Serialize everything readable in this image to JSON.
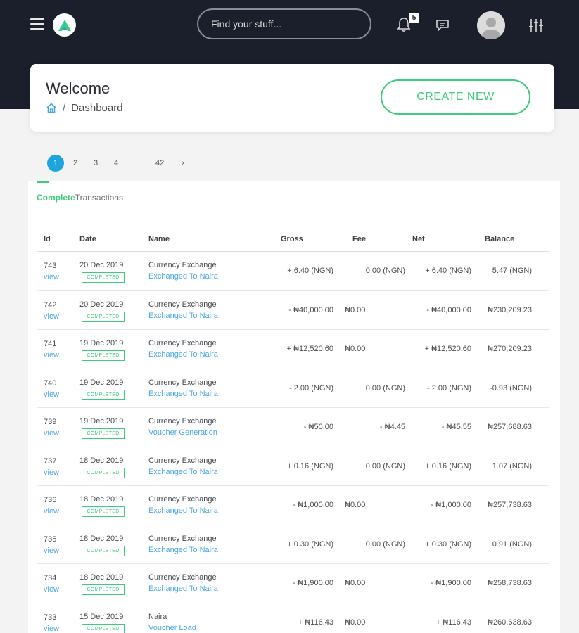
{
  "header": {
    "search_placeholder": "Find your stuff...",
    "notification_count": "5"
  },
  "welcome": {
    "title": "Welcome",
    "breadcrumb": "Dashboard",
    "create_label": "CREATE NEW"
  },
  "pagination": {
    "pages": [
      "1",
      "2",
      "3",
      "4",
      "42",
      "›"
    ],
    "current": "1"
  },
  "panel": {
    "title_highlight": "Complete",
    "title_rest": "Transactions"
  },
  "table": {
    "columns": [
      "Id",
      "Date",
      "Name",
      "Gross",
      "Fee",
      "Net",
      "Balance"
    ],
    "rows": [
      {
        "id": "743",
        "view": "view",
        "date": "20 Dec 2019",
        "status": "COMPLETED",
        "name": "Currency Exchange",
        "sub": "Exchanged To Naira",
        "gross": "+ 6.40 (NGN)",
        "fee": "0.00 (NGN)",
        "net": "+ 6.40 (NGN)",
        "balance": "5.47 (NGN)"
      },
      {
        "id": "742",
        "view": "view",
        "date": "20 Dec 2019",
        "status": "COMPLETED",
        "name": "Currency Exchange",
        "sub": "Exchanged To Naira",
        "gross": "- ₦40,000.00",
        "fee": "₦0.00",
        "net": "- ₦40,000.00",
        "balance": "₦230,209.23"
      },
      {
        "id": "741",
        "view": "view",
        "date": "19 Dec 2019",
        "status": "COMPLETED",
        "name": "Currency Exchange",
        "sub": "Exchanged To Naira",
        "gross": "+ ₦12,520.60",
        "fee": "₦0.00",
        "net": "+ ₦12,520.60",
        "balance": "₦270,209.23"
      },
      {
        "id": "740",
        "view": "view",
        "date": "19 Dec 2019",
        "status": "COMPLETED",
        "name": "Currency Exchange",
        "sub": "Exchanged To Naira",
        "gross": "- 2.00 (NGN)",
        "fee": "0.00 (NGN)",
        "net": "- 2.00 (NGN)",
        "balance": "-0.93 (NGN)"
      },
      {
        "id": "739",
        "view": "view",
        "date": "19 Dec 2019",
        "status": "COMPLETED",
        "name": "Currency Exchange",
        "sub": "Voucher Generation",
        "gross": "- ₦50.00",
        "fee": "- ₦4.45",
        "net": "- ₦45.55",
        "balance": "₦257,688.63"
      },
      {
        "id": "737",
        "view": "view",
        "date": "18 Dec 2019",
        "status": "COMPLETED",
        "name": "Currency Exchange",
        "sub": "Exchanged To Naira",
        "gross": "+ 0.16 (NGN)",
        "fee": "0.00 (NGN)",
        "net": "+ 0.16 (NGN)",
        "balance": "1.07 (NGN)"
      },
      {
        "id": "736",
        "view": "view",
        "date": "18 Dec 2019",
        "status": "COMPLETED",
        "name": "Currency Exchange",
        "sub": "Exchanged To Naira",
        "gross": "- ₦1,000.00",
        "fee": "₦0.00",
        "net": "- ₦1,000.00",
        "balance": "₦257,738.63"
      },
      {
        "id": "735",
        "view": "view",
        "date": "18 Dec 2019",
        "status": "COMPLETED",
        "name": "Currency Exchange",
        "sub": "Exchanged To Naira",
        "gross": "+ 0.30 (NGN)",
        "fee": "0.00 (NGN)",
        "net": "+ 0.30 (NGN)",
        "balance": "0.91 (NGN)"
      },
      {
        "id": "734",
        "view": "view",
        "date": "18 Dec 2019",
        "status": "COMPLETED",
        "name": "Currency Exchange",
        "sub": "Exchanged To Naira",
        "gross": "- ₦1,900.00",
        "fee": "₦0.00",
        "net": "- ₦1,900.00",
        "balance": "₦258,738.63"
      },
      {
        "id": "733",
        "view": "view",
        "date": "15 Dec 2019",
        "status": "COMPLETED",
        "name": "Naira",
        "sub": "Voucher Load",
        "gross": "+ ₦116.43",
        "fee": "₦0.00",
        "net": "+ ₦116.43",
        "balance": "₦260,638.63"
      }
    ]
  },
  "colors": {
    "header_bg": "#1b1f2b",
    "accent_green": "#3dcb7d",
    "link_blue": "#4aa8e0",
    "page_active": "#1ea5e0"
  }
}
